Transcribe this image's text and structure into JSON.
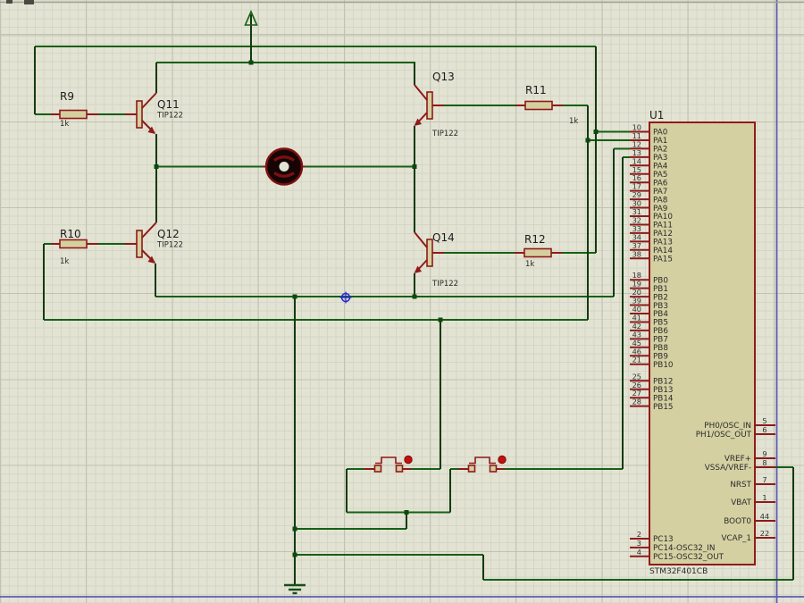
{
  "app": {
    "description": "Proteus schematic sheet - H-bridge DC motor driver with STM32"
  },
  "colors": {
    "background": "#e3e3d3",
    "wire_green": "#166016",
    "component_red": "#8e1a1a",
    "fill_khaki": "#d5cf9f",
    "chip_fill": "#d4d0a2",
    "sheet_border_blue": "#5b5bb8",
    "button_dot_red": "#c40f0f",
    "motor_fill": "#170505",
    "origin_marker_blue": "#2626d8"
  },
  "components": {
    "q11": {
      "ref": "Q11",
      "value": "TIP122"
    },
    "q12": {
      "ref": "Q12",
      "value": "TIP122"
    },
    "q13": {
      "ref": "Q13",
      "value": "TIP122"
    },
    "q14": {
      "ref": "Q14",
      "value": "TIP122"
    },
    "r9": {
      "ref": "R9",
      "value": "1k"
    },
    "r10": {
      "ref": "R10",
      "value": "1k"
    },
    "r11": {
      "ref": "R11",
      "value": "1k"
    },
    "r12": {
      "ref": "R12",
      "value": "1k"
    },
    "u1": {
      "ref": "U1",
      "part": "STM32F401CB"
    }
  },
  "chip": {
    "pa": [
      {
        "n": "10",
        "name": "PA0"
      },
      {
        "n": "11",
        "name": "PA1"
      },
      {
        "n": "12",
        "name": "PA2"
      },
      {
        "n": "13",
        "name": "PA3"
      },
      {
        "n": "14",
        "name": "PA4"
      },
      {
        "n": "15",
        "name": "PA5"
      },
      {
        "n": "16",
        "name": "PA6"
      },
      {
        "n": "17",
        "name": "PA7"
      },
      {
        "n": "29",
        "name": "PA8"
      },
      {
        "n": "30",
        "name": "PA9"
      },
      {
        "n": "31",
        "name": "PA10"
      },
      {
        "n": "32",
        "name": "PA11"
      },
      {
        "n": "33",
        "name": "PA12"
      },
      {
        "n": "34",
        "name": "PA13"
      },
      {
        "n": "37",
        "name": "PA14"
      },
      {
        "n": "38",
        "name": "PA15"
      }
    ],
    "pb_a": [
      {
        "n": "18",
        "name": "PB0"
      },
      {
        "n": "19",
        "name": "PB1"
      },
      {
        "n": "20",
        "name": "PB2"
      },
      {
        "n": "39",
        "name": "PB3"
      },
      {
        "n": "40",
        "name": "PB4"
      },
      {
        "n": "41",
        "name": "PB5"
      },
      {
        "n": "42",
        "name": "PB6"
      },
      {
        "n": "43",
        "name": "PB7"
      },
      {
        "n": "45",
        "name": "PB8"
      },
      {
        "n": "46",
        "name": "PB9"
      },
      {
        "n": "21",
        "name": "PB10"
      }
    ],
    "pb_b": [
      {
        "n": "25",
        "name": "PB12"
      },
      {
        "n": "26",
        "name": "PB13"
      },
      {
        "n": "27",
        "name": "PB14"
      },
      {
        "n": "28",
        "name": "PB15"
      }
    ],
    "pc": [
      {
        "n": "2",
        "name": "PC13"
      },
      {
        "n": "3",
        "name": "PC14-OSC32_IN"
      },
      {
        "n": "4",
        "name": "PC15-OSC32_OUT"
      }
    ],
    "right": [
      {
        "n": "5",
        "name": "PH0/OSC_IN"
      },
      {
        "n": "6",
        "name": "PH1/OSC_OUT"
      },
      {
        "n": "9",
        "name": "VREF+"
      },
      {
        "n": "8",
        "name": "VSSA/VREF-"
      },
      {
        "n": "7",
        "name": "NRST"
      },
      {
        "n": "1",
        "name": "VBAT"
      },
      {
        "n": "44",
        "name": "BOOT0"
      },
      {
        "n": "22",
        "name": "VCAP_1"
      }
    ]
  }
}
